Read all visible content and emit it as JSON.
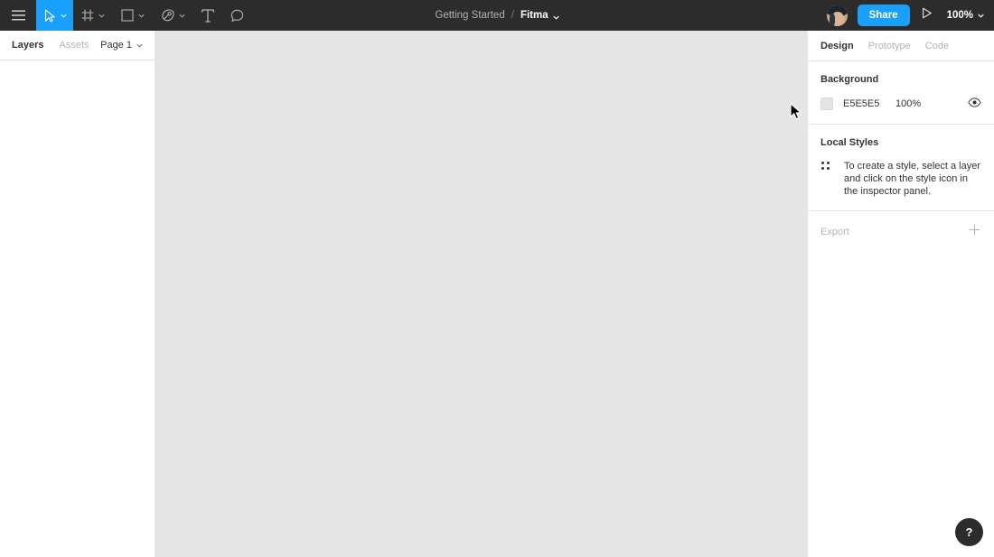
{
  "app": {
    "accent_color": "#18a0fb",
    "toolbar_bg": "#2c2c2c",
    "canvas_color": "#e5e5e5"
  },
  "toolbar": {
    "menu_icon": "hamburger-menu-icon",
    "tools": [
      {
        "id": "move",
        "icon": "cursor-arrow-icon",
        "has_caret": true,
        "active": true
      },
      {
        "id": "frame",
        "icon": "frame-grid-icon",
        "has_caret": true,
        "active": false
      },
      {
        "id": "shape",
        "icon": "square-shape-icon",
        "has_caret": true,
        "active": false
      },
      {
        "id": "pen",
        "icon": "pen-tool-icon",
        "has_caret": true,
        "active": false
      },
      {
        "id": "text",
        "icon": "text-tool-icon",
        "has_caret": false,
        "active": false
      },
      {
        "id": "comment",
        "icon": "comment-bubble-icon",
        "has_caret": false,
        "active": false
      }
    ],
    "breadcrumb": {
      "project": "Getting Started",
      "separator": "/",
      "file": "Fitma"
    },
    "avatar": "user-avatar",
    "share_label": "Share",
    "present_icon": "play-present-icon",
    "zoom_level": "100%"
  },
  "left_panel": {
    "tabs": [
      {
        "label": "Layers",
        "active": true
      },
      {
        "label": "Assets",
        "active": false
      }
    ],
    "page_selector": "Page 1"
  },
  "right_panel": {
    "tabs": [
      {
        "label": "Design",
        "active": true
      },
      {
        "label": "Prototype",
        "active": false
      },
      {
        "label": "Code",
        "active": false
      }
    ],
    "background": {
      "title": "Background",
      "hex": "E5E5E5",
      "opacity": "100%",
      "visibility_icon": "eye-icon"
    },
    "local_styles": {
      "title": "Local Styles",
      "icon": "four-dots-icon",
      "empty_message": "To create a style, select a layer and click on the style icon in the inspector panel."
    },
    "export": {
      "label": "Export",
      "add_icon": "plus-icon"
    }
  },
  "help": {
    "label": "?"
  }
}
